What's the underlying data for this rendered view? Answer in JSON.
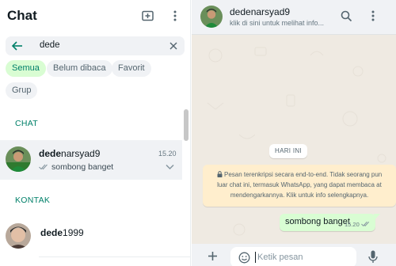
{
  "app": {
    "title": "Chat"
  },
  "search": {
    "value": "dede"
  },
  "filters": [
    {
      "label": "Semua",
      "active": true
    },
    {
      "label": "Belum dibaca",
      "active": false
    },
    {
      "label": "Favorit",
      "active": false
    },
    {
      "label": "Grup",
      "active": false
    }
  ],
  "sections": {
    "chats": "CHAT",
    "contacts": "KONTAK"
  },
  "chat_result": {
    "name_match": "dede",
    "name_rest": "narsyad9",
    "time": "15.20",
    "message": "sombong banget"
  },
  "contact_result": {
    "name_match": "dede",
    "name_rest": "1999"
  },
  "conversation": {
    "name": "dedenarsyad9",
    "subtitle": "klik di sini untuk melihat info...",
    "date_chip": "HARI INI",
    "encryption_lines": [
      "Pesan terenkripsi secara end-to-end. Tidak seorang pun",
      "luar chat ini, termasuk WhatsApp, yang dapat membaca at",
      "mendengarkannya. Klik untuk info selengkapnya."
    ],
    "message": {
      "text": "sombong banget",
      "time": "15.20"
    }
  },
  "composer": {
    "placeholder": "Ketik pesan"
  },
  "colors": {
    "accent": "#008069",
    "bubble": "#d9fdd3",
    "chat_bg": "#efeae2",
    "notice": "#ffeecd"
  },
  "icons": [
    "new-chat-icon",
    "menu-dots-icon",
    "back-arrow-icon",
    "clear-icon",
    "search-icon",
    "chevron-down-icon",
    "double-check-icon",
    "lock-icon",
    "plus-icon",
    "emoji-icon",
    "mic-icon"
  ]
}
